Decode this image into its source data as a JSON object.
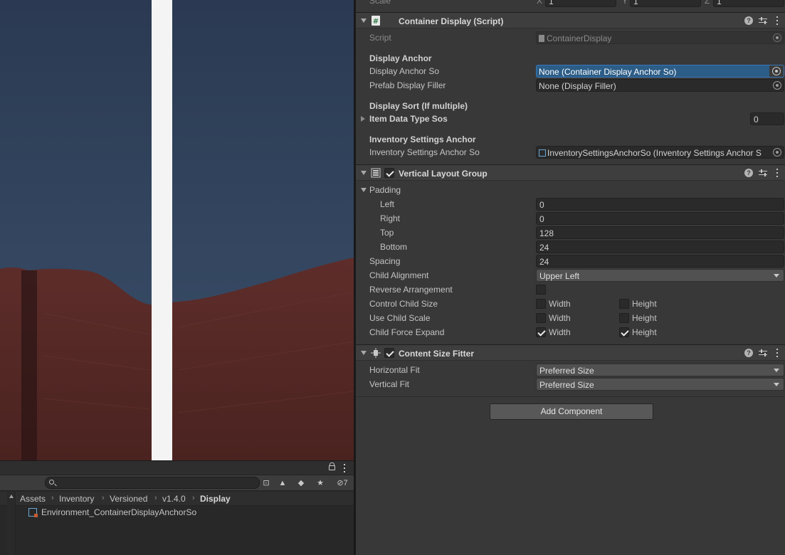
{
  "scene": {},
  "inspector": {
    "transform_partial": {
      "label": "Scale",
      "x_label": "X",
      "x": "1",
      "y_label": "Y",
      "y": "1",
      "z_label": "Z",
      "z": "1"
    },
    "container_display": {
      "title": "Container Display (Script)",
      "script_label": "Script",
      "script_value": "ContainerDisplay",
      "section_display_anchor": "Display Anchor",
      "display_anchor_so_label": "Display Anchor So",
      "display_anchor_so_value": "None (Container Display Anchor So)",
      "prefab_display_filler_label": "Prefab Display Filler",
      "prefab_display_filler_value": "None (Display Filler)",
      "section_display_sort": "Display Sort (If multiple)",
      "item_data_type_sos_label": "Item Data Type Sos",
      "item_data_type_sos_count": "0",
      "section_inventory_settings": "Inventory Settings Anchor",
      "inventory_settings_anchor_so_label": "Inventory Settings Anchor So",
      "inventory_settings_anchor_so_value": "InventorySettingsAnchorSo (Inventory Settings Anchor S"
    },
    "vertical_layout_group": {
      "title": "Vertical Layout Group",
      "padding_label": "Padding",
      "left_label": "Left",
      "left_value": "0",
      "right_label": "Right",
      "right_value": "0",
      "top_label": "Top",
      "top_value": "128",
      "bottom_label": "Bottom",
      "bottom_value": "24",
      "spacing_label": "Spacing",
      "spacing_value": "24",
      "child_alignment_label": "Child Alignment",
      "child_alignment_value": "Upper Left",
      "reverse_arrangement_label": "Reverse Arrangement",
      "control_child_size_label": "Control Child Size",
      "use_child_scale_label": "Use Child Scale",
      "child_force_expand_label": "Child Force Expand",
      "width_label": "Width",
      "height_label": "Height"
    },
    "content_size_fitter": {
      "title": "Content Size Fitter",
      "horizontal_fit_label": "Horizontal Fit",
      "horizontal_fit_value": "Preferred Size",
      "vertical_fit_label": "Vertical Fit",
      "vertical_fit_value": "Preferred Size"
    },
    "add_component_label": "Add Component"
  },
  "project": {
    "hidden_count": "7",
    "breadcrumbs": [
      "Assets",
      "Inventory",
      "Versioned",
      "v1.4.0",
      "Display"
    ],
    "asset_name": "Environment_ContainerDisplayAnchorSo"
  },
  "colors": {
    "inspector_bg": "#383838",
    "selection": "#2c5d87",
    "sky": "#33455f",
    "wall": "#5b2b28",
    "pillar": "#f4f4f4"
  }
}
